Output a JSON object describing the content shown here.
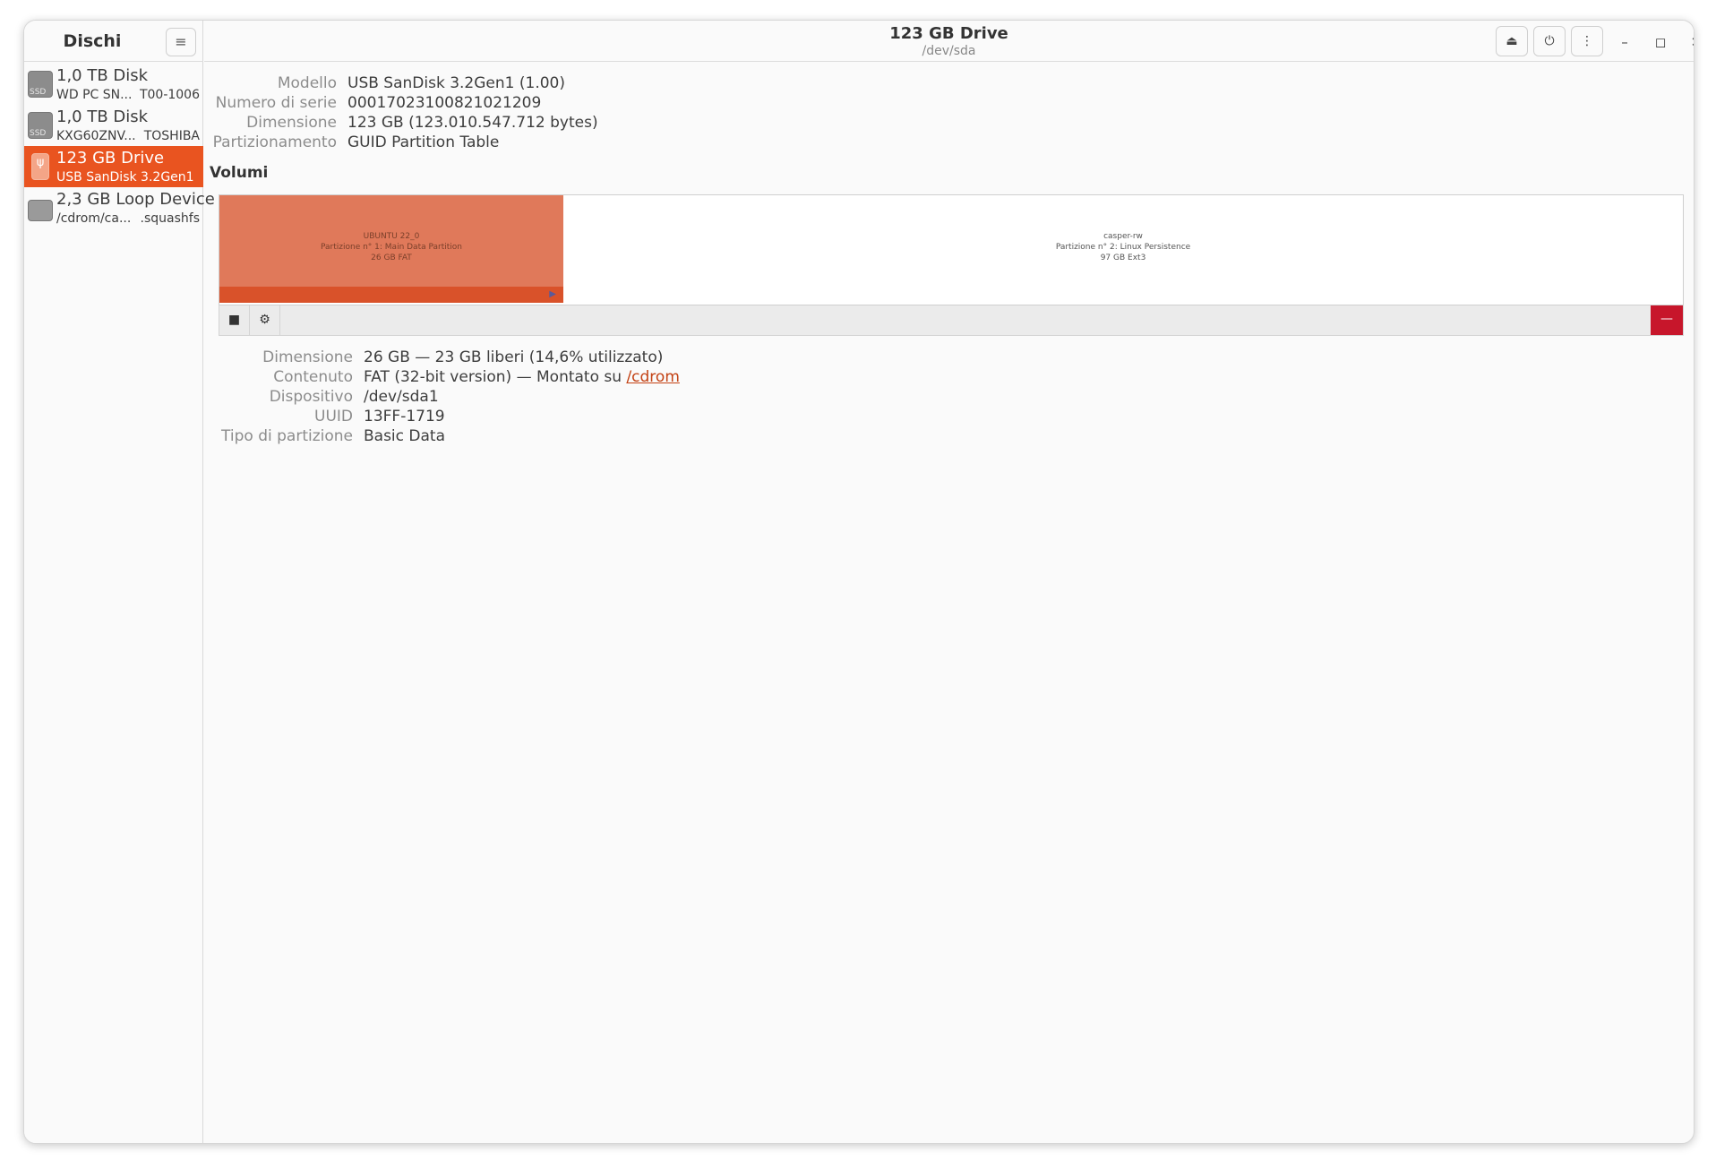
{
  "sidebar": {
    "title": "Dischi",
    "menu_icon": "hamburger-icon",
    "disks": [
      {
        "name": "1,0 TB Disk",
        "sub_left": "WD PC SN...",
        "sub_right": "T00-1006",
        "icon": "ssd-icon",
        "tag": "SSD"
      },
      {
        "name": "1,0 TB Disk",
        "sub_left": "KXG60ZNV...",
        "sub_right": "TOSHIBA",
        "icon": "ssd-icon",
        "tag": "SSD"
      },
      {
        "name": "123 GB Drive",
        "sub_left": "USB SanDisk 3.2Gen1",
        "sub_right": "",
        "icon": "usb-drive-icon",
        "selected": true
      },
      {
        "name": "2,3 GB Loop Device",
        "sub_left": "/cdrom/ca...",
        "sub_right": ".squashfs",
        "icon": "loop-device-icon"
      }
    ]
  },
  "header": {
    "title": "123 GB Drive",
    "subtitle": "/dev/sda",
    "buttons": [
      "eject-icon",
      "power-icon",
      "more-options-icon"
    ],
    "window_controls": [
      "minimize-icon",
      "maximize-icon",
      "close-icon"
    ]
  },
  "drive_info": {
    "model_label": "Modello",
    "model_value": "USB SanDisk 3.2Gen1 (1.00)",
    "serial_label": "Numero di serie",
    "serial_value": "00017023100821021209",
    "size_label": "Dimensione",
    "size_value": "123 GB (123.010.547.712 bytes)",
    "partitioning_label": "Partizionamento",
    "partitioning_value": "GUID Partition Table"
  },
  "volumes": {
    "title": "Volumi",
    "partitions": [
      {
        "name": "UBUNTU 22_0",
        "desc": "Partizione n° 1: Main Data Partition",
        "size": "26 GB FAT",
        "selected": true
      },
      {
        "name": "casper-rw",
        "desc": "Partizione n° 2: Linux Persistence",
        "size": "97 GB Ext3"
      }
    ],
    "toolbar": {
      "stop": "stop-icon",
      "settings": "gear-icon",
      "delete": "minus-icon"
    }
  },
  "partition_info": {
    "size_label": "Dimensione",
    "size_value": "26 GB — 23 GB liberi (14,6% utilizzato)",
    "content_label": "Contenuto",
    "content_value": "FAT (32-bit version) — Montato su ",
    "content_link": "/cdrom",
    "device_label": "Dispositivo",
    "device_value": "/dev/sda1",
    "uuid_label": "UUID",
    "uuid_value": "13FF-1719",
    "type_label": "Tipo di partizione",
    "type_value": "Basic Data"
  },
  "colors": {
    "accent": "#e95420",
    "partition_fill": "#e0795a",
    "delete": "#c7162b"
  }
}
